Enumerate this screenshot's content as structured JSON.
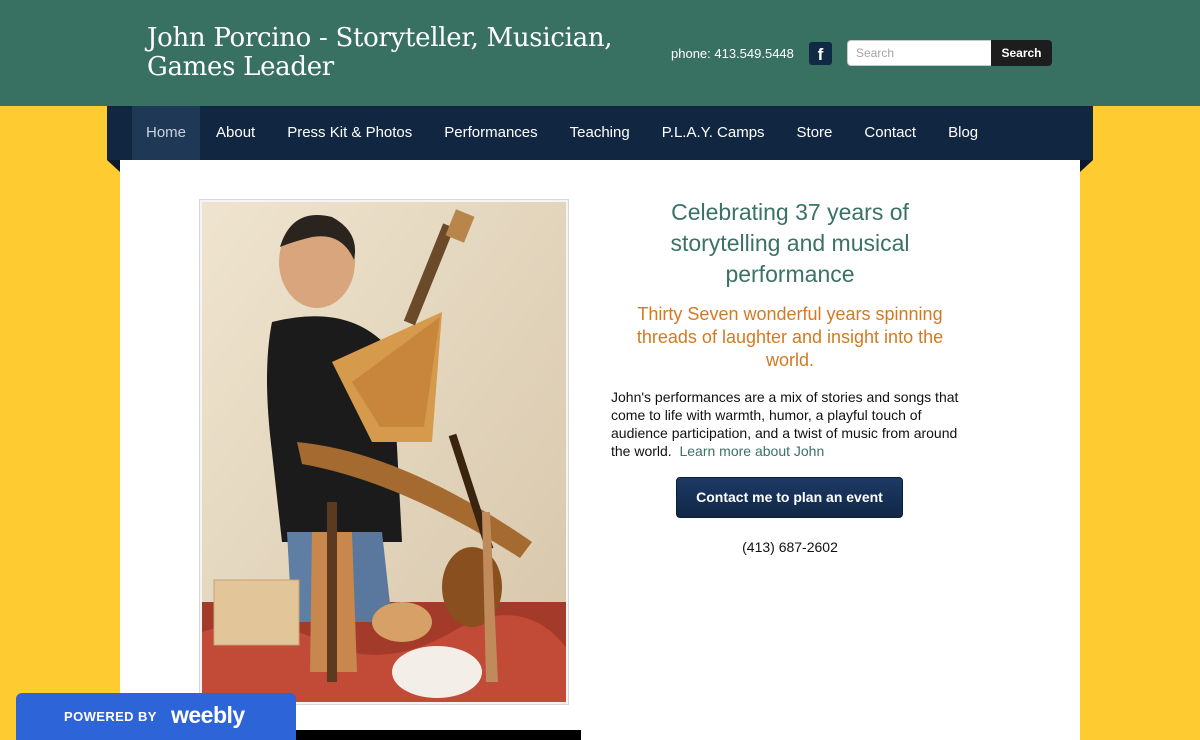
{
  "header": {
    "title": "John Porcino -  Storyteller, Musician, Games Leader",
    "phone": "phone: 413.549.5448",
    "facebook_glyph": "f",
    "search_placeholder": "Search",
    "search_button": "Search"
  },
  "nav": {
    "items": [
      {
        "label": "Home"
      },
      {
        "label": "About"
      },
      {
        "label": "Press Kit & Photos"
      },
      {
        "label": "Performances"
      },
      {
        "label": "Teaching"
      },
      {
        "label": "P.L.A.Y. Camps"
      },
      {
        "label": "Store"
      },
      {
        "label": "Contact"
      },
      {
        "label": "Blog"
      }
    ],
    "active": "Home"
  },
  "main": {
    "headline": "Celebrating 37 years of storytelling and musical performance",
    "subhead": "Thirty Seven wonderful years spinning threads of laughter and insight into the world.",
    "body": "John's performances are a mix of stories and songs that come to life with warmth, humor, a playful touch of audience participation, and a twist of music from around the world.",
    "learn_more": "Learn more about John",
    "cta_label": "Contact me to plan an event",
    "cta_phone": "(413) 687-2602"
  },
  "badge": {
    "powered_by": "POWERED BY",
    "brand": "weebly"
  },
  "colors": {
    "page_background": "#fecb30",
    "header_background": "#387062",
    "nav_background": "#112640",
    "headline": "#3a7266",
    "subhead": "#d27a22",
    "badge": "#2d64d8"
  },
  "icons": [
    "facebook-icon"
  ]
}
